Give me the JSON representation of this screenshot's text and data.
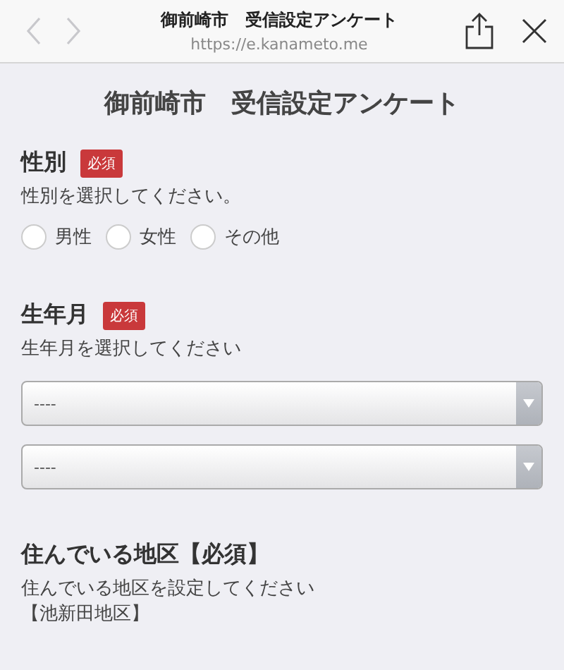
{
  "browser": {
    "title": "御前崎市　受信設定アンケート",
    "url": "https://e.kanameto.me",
    "back": {
      "disabled": true
    },
    "forward": {
      "disabled": true
    }
  },
  "page_title": "御前崎市　受信設定アンケート",
  "sections": [
    {
      "kind": "radio",
      "title": "性別",
      "badge": "必須",
      "description": "性別を選択してください。",
      "options": [
        {
          "label": "男性",
          "selected": false
        },
        {
          "label": "女性",
          "selected": false
        },
        {
          "label": "その他",
          "selected": false
        }
      ]
    },
    {
      "kind": "select",
      "title": "生年月",
      "badge": "必須",
      "description": "生年月を選択してください",
      "selects": [
        {
          "value": "----"
        },
        {
          "value": "----"
        }
      ]
    },
    {
      "kind": "text",
      "title": "住んでいる地区【必須】",
      "description": "住んでいる地区を設定してください",
      "note": "【池新田地区】"
    }
  ]
}
